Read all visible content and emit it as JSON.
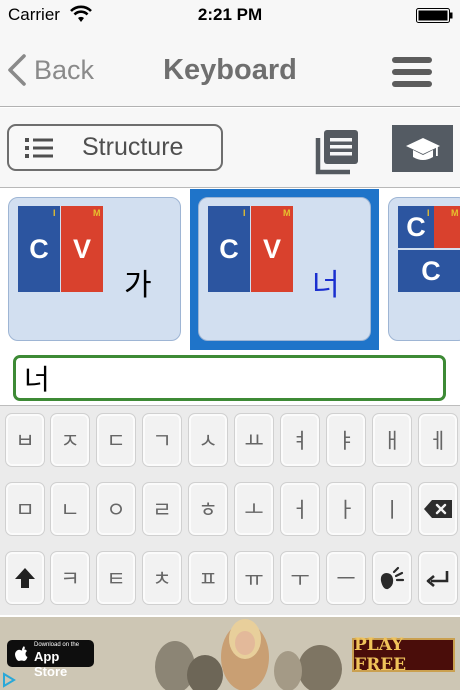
{
  "status_bar": {
    "carrier": "Carrier",
    "time": "2:21 PM"
  },
  "nav": {
    "back_label": "Back",
    "title": "Keyboard"
  },
  "toolbar": {
    "structure_label": "Structure"
  },
  "cards": [
    {
      "consonant": "C",
      "vowel": "V",
      "initial_mark": "I",
      "medial_mark": "M",
      "syllable": "가",
      "selected": false
    },
    {
      "consonant": "C",
      "vowel": "V",
      "initial_mark": "I",
      "medial_mark": "M",
      "syllable": "너",
      "selected": true
    },
    {
      "top_consonant": "C",
      "bottom_consonant": "C",
      "initial_mark": "I",
      "medial_mark": "M",
      "partial": true
    }
  ],
  "input": {
    "value": "너"
  },
  "keyboard": {
    "row1": [
      "ㅂ",
      "ㅈ",
      "ㄷ",
      "ㄱ",
      "ㅅ",
      "ㅛ",
      "ㅕ",
      "ㅑ",
      "ㅐ",
      "ㅔ"
    ],
    "row2": [
      "ㅁ",
      "ㄴ",
      "ㅇ",
      "ㄹ",
      "ㅎ",
      "ㅗ",
      "ㅓ",
      "ㅏ",
      "ㅣ"
    ],
    "row3": [
      "ㅋ",
      "ㅌ",
      "ㅊ",
      "ㅍ",
      "ㅠ",
      "ㅜ",
      "ㅡ"
    ],
    "icons": {
      "shift": "shift-icon",
      "backspace": "backspace-icon",
      "speak": "speak-icon",
      "return": "return-icon"
    }
  },
  "ad": {
    "store_small": "Download on the",
    "store_big": "App Store",
    "cta": "PLAY FREE"
  },
  "colors": {
    "consonant_block": "#2c55a0",
    "vowel_block": "#d9412d",
    "selected_card": "#1f74c9",
    "input_border": "#3d8a35",
    "selected_syllable": "#1a2fcf"
  }
}
